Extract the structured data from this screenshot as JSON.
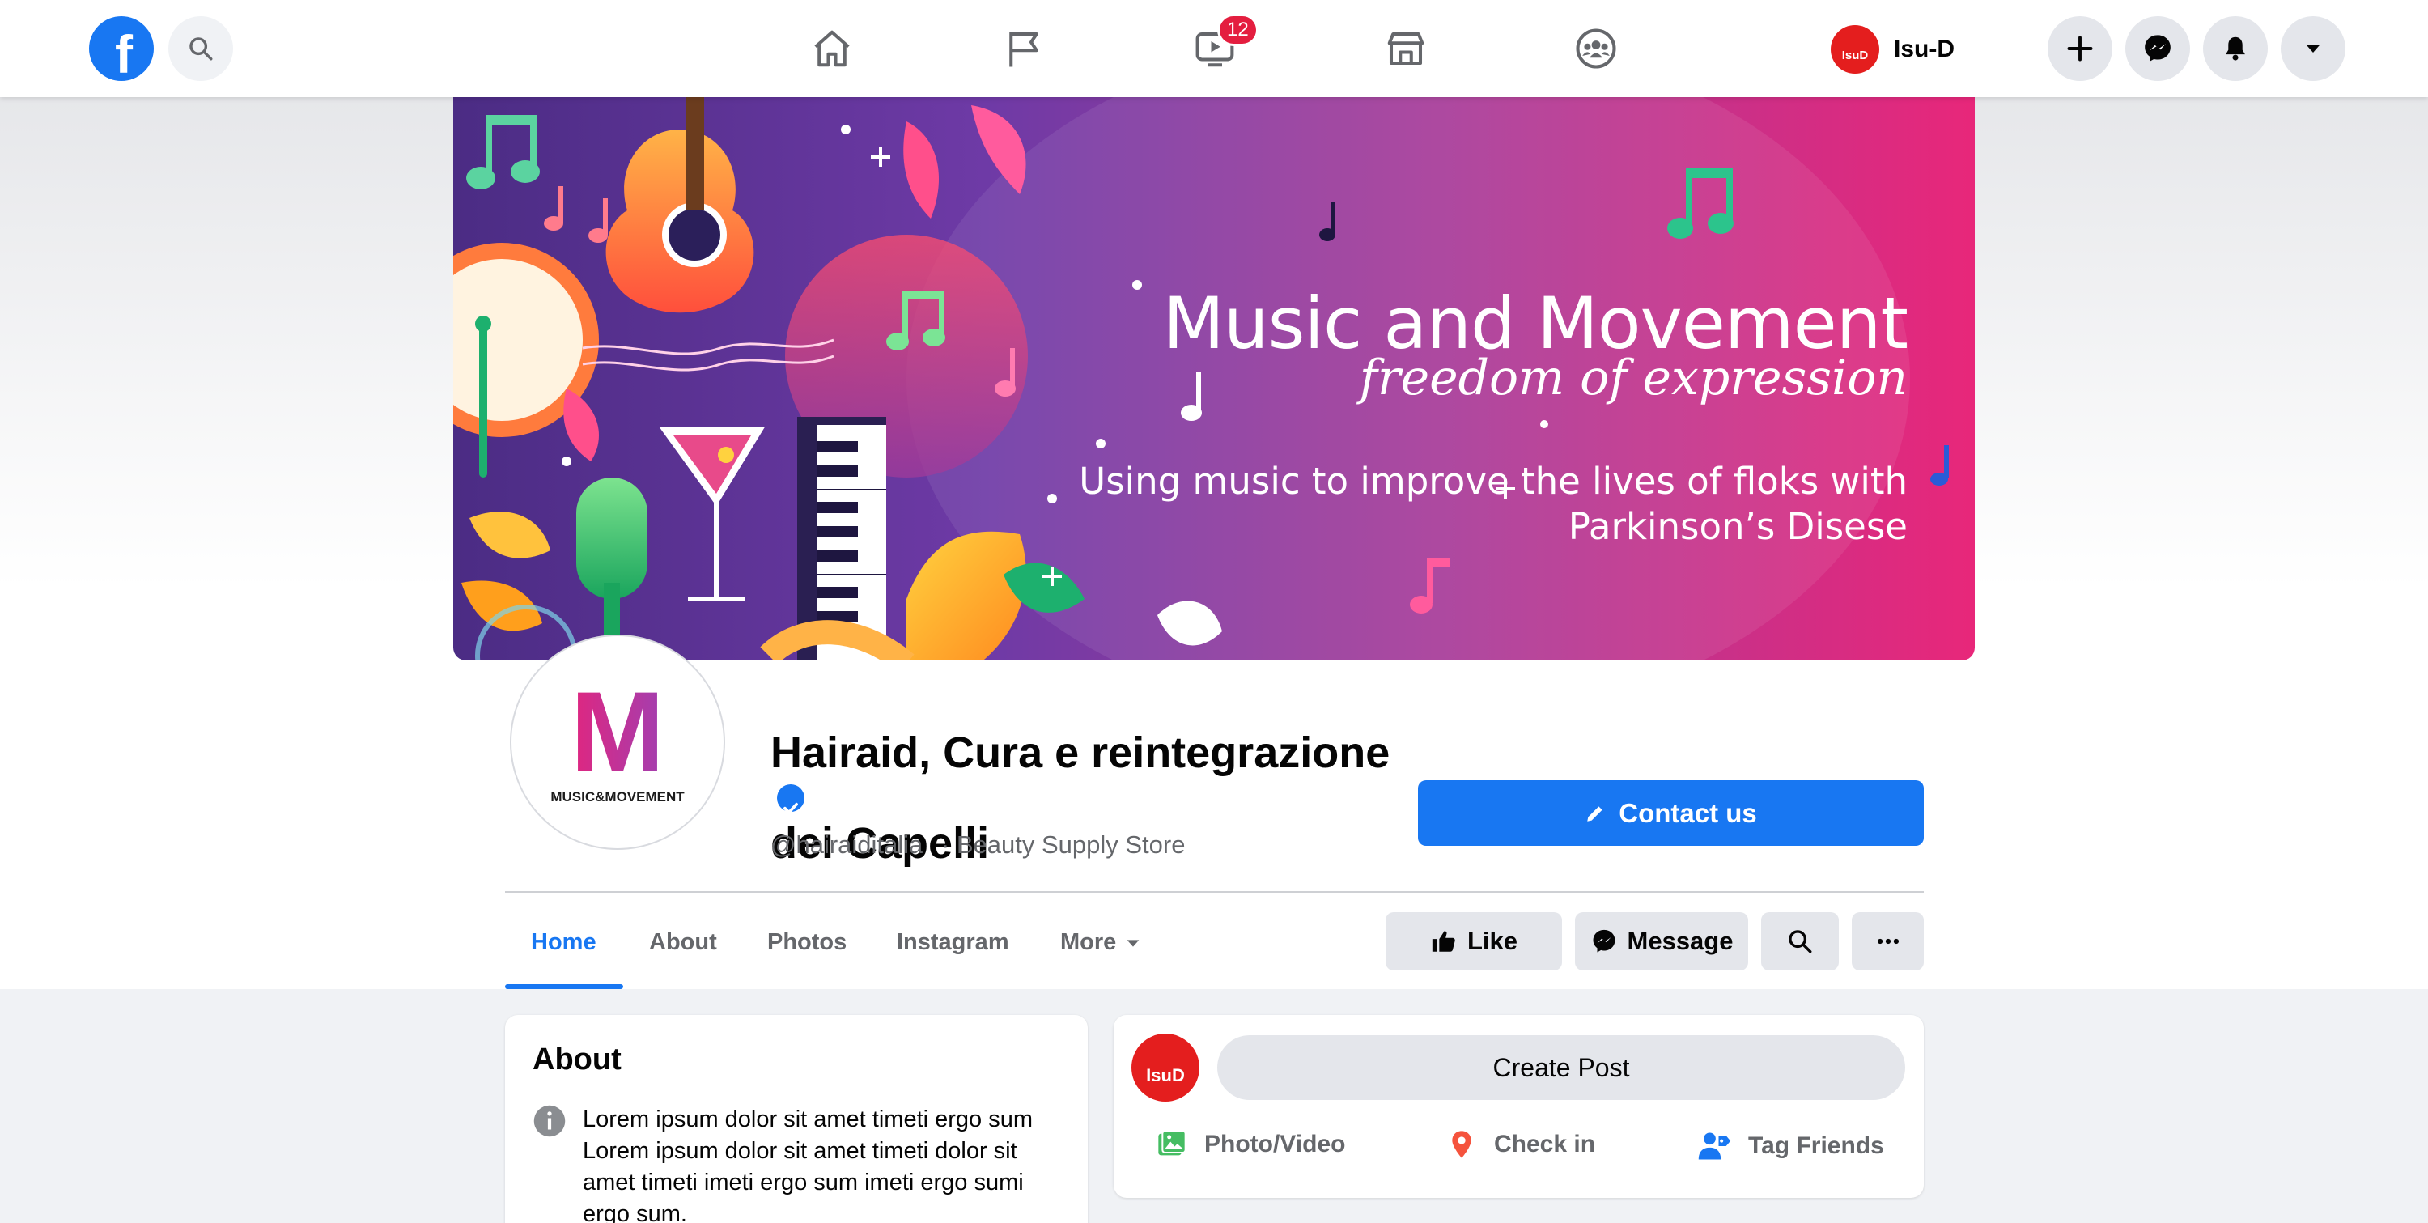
{
  "topbar": {
    "logo": "f",
    "search_icon": "search-icon",
    "nav": [
      {
        "name": "home-icon"
      },
      {
        "name": "pages-flag-icon"
      },
      {
        "name": "watch-icon",
        "badge": "12"
      },
      {
        "name": "marketplace-icon"
      },
      {
        "name": "groups-icon"
      }
    ],
    "user": {
      "avatar_text": "IsuD",
      "name": "Isu-D"
    },
    "right_buttons": [
      "plus-icon",
      "messenger-icon",
      "bell-icon",
      "caret-down-icon"
    ]
  },
  "cover": {
    "title": "Music and Movement",
    "subtitle": "freedom of expression",
    "tagline_line1": "Using music to improve the lives of floks with",
    "tagline_line2": "Parkinson’s Disese"
  },
  "profile": {
    "logo_letter": "M",
    "logo_caption": "MUSIC&MOVEMENT",
    "name_line1": "Hairaid, Cura e reintegrazione",
    "name_line2": "dei Capelli",
    "handle": "@hairaiditalia",
    "category": "· Beauty Supply Store",
    "contact_label": "Contact us"
  },
  "tabs": [
    {
      "label": "Home",
      "active": true
    },
    {
      "label": "About"
    },
    {
      "label": "Photos"
    },
    {
      "label": "Instagram"
    },
    {
      "label": "More"
    }
  ],
  "actions": {
    "like": "Like",
    "message": "Message"
  },
  "about": {
    "heading": "About",
    "text": "Lorem ipsum dolor sit amet timeti ergo sum Lorem ipsum dolor sit amet timeti dolor sit amet timeti imeti ergo sum imeti ergo sumi ergo sum."
  },
  "composer": {
    "avatar_text": "IsuD",
    "create_post": "Create Post",
    "photo_video": "Photo/Video",
    "check_in": "Check in",
    "tag_friends": "Tag Friends"
  },
  "colors": {
    "accent": "#1877f2",
    "badge": "#e41e3f",
    "avatar": "#e41e1e"
  }
}
